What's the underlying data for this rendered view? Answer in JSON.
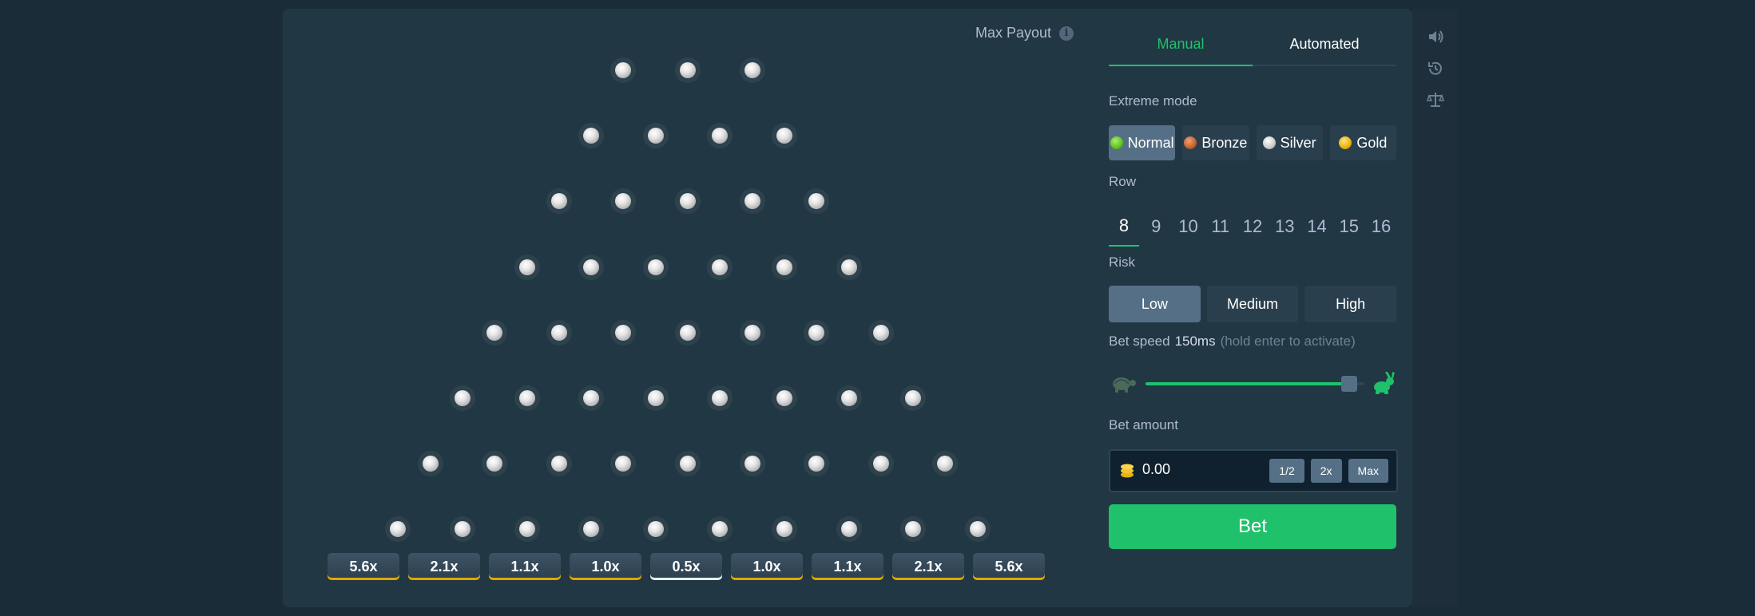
{
  "board": {
    "max_payout_label": "Max Payout",
    "info_glyph": "i",
    "peg_rows": 8,
    "multipliers": [
      "5.6x",
      "2.1x",
      "1.1x",
      "1.0x",
      "0.5x",
      "1.0x",
      "1.1x",
      "2.1x",
      "5.6x"
    ]
  },
  "panel": {
    "tabs": [
      {
        "label": "Manual",
        "active": true
      },
      {
        "label": "Automated",
        "active": false
      }
    ],
    "extreme_label": "Extreme mode",
    "modes": [
      {
        "label": "Normal",
        "color": "#5ec220",
        "active": true
      },
      {
        "label": "Bronze",
        "color": "#c0622f",
        "active": false
      },
      {
        "label": "Silver",
        "color": "#c9c9c9",
        "active": false
      },
      {
        "label": "Gold",
        "color": "#e8b20c",
        "active": false
      }
    ],
    "row_label": "Row",
    "rows": [
      "8",
      "9",
      "10",
      "11",
      "12",
      "13",
      "14",
      "15",
      "16"
    ],
    "selected_row": "8",
    "risk_label": "Risk",
    "risks": [
      {
        "label": "Low",
        "active": true
      },
      {
        "label": "Medium",
        "active": false
      },
      {
        "label": "High",
        "active": false
      }
    ],
    "speed_label": "Bet speed",
    "speed_value": "150ms",
    "speed_hint": "(hold enter to activate)",
    "speed_level": 0.93,
    "bet_amount_label": "Bet amount",
    "bet_amount": "0.00",
    "quick_buttons": [
      "1/2",
      "2x",
      "Max"
    ],
    "bet_button": "Bet"
  },
  "sidebar": {
    "icons": [
      "volume-icon",
      "history-icon",
      "fairness-scale-icon"
    ]
  },
  "colors": {
    "accent": "#1fc16b",
    "board": "#213743",
    "background": "#1a2c38"
  }
}
